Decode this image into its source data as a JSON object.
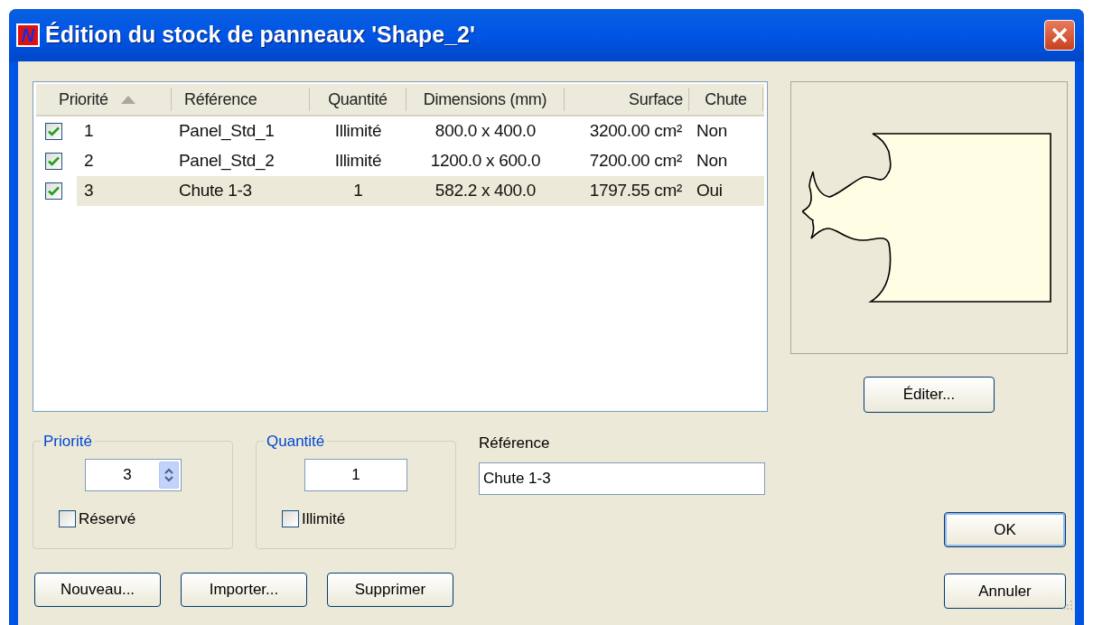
{
  "window": {
    "title": "Édition du stock de panneaux 'Shape_2'",
    "icon_letter": "N"
  },
  "table": {
    "columns": [
      {
        "label": "Priorité",
        "sorted": true
      },
      {
        "label": "Référence",
        "sorted": false
      },
      {
        "label": "Quantité",
        "sorted": false
      },
      {
        "label": "Dimensions (mm)",
        "sorted": false
      },
      {
        "label": "Surface",
        "sorted": false
      },
      {
        "label": "Chute",
        "sorted": false
      }
    ],
    "rows": [
      {
        "checked": true,
        "selected": false,
        "cells": [
          "1",
          "Panel_Std_1",
          "Illimité",
          "800.0 x 400.0",
          "3200.00 cm²",
          "Non"
        ]
      },
      {
        "checked": true,
        "selected": false,
        "cells": [
          "2",
          "Panel_Std_2",
          "Illimité",
          "1200.0 x 600.0",
          "7200.00 cm²",
          "Non"
        ]
      },
      {
        "checked": true,
        "selected": true,
        "cells": [
          "3",
          "Chute 1-3",
          "1",
          "582.2 x 400.0",
          "1797.55 cm²",
          "Oui"
        ]
      }
    ]
  },
  "priority_group": {
    "legend": "Priorité",
    "value": "3",
    "checkbox": {
      "label": "Réservé",
      "checked": false
    }
  },
  "quantity_group": {
    "legend": "Quantité",
    "value": "1",
    "checkbox": {
      "label": "Illimité",
      "checked": false
    }
  },
  "reference": {
    "label": "Référence",
    "value": "Chute 1-3"
  },
  "left_buttons": [
    "Nouveau...",
    "Importer...",
    "Supprimer"
  ],
  "edit_button": "Éditer...",
  "dialog_buttons": [
    {
      "label": "OK",
      "default": true
    },
    {
      "label": "Annuler",
      "default": false
    }
  ]
}
